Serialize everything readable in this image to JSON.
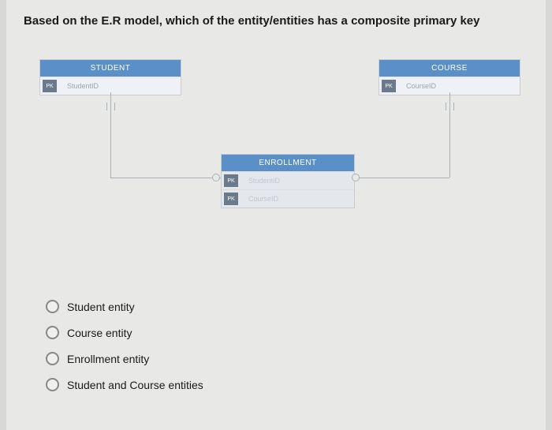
{
  "question": "Based on the E.R model, which of the entity/entities has a composite primary key",
  "entities": {
    "student": {
      "title": "STUDENT",
      "pk_label": "PK",
      "attr": "StudentID"
    },
    "course": {
      "title": "COURSE",
      "pk_label": "PK",
      "attr": "CourseID"
    },
    "enrollment": {
      "title": "ENROLLMENT",
      "row1_pk": "PK",
      "row1_attr": "StudentID",
      "row2_pk": "PK",
      "row2_attr": "CourseID"
    }
  },
  "options": [
    "Student entity",
    "Course entity",
    "Enrollment entity",
    "Student and Course entities"
  ]
}
